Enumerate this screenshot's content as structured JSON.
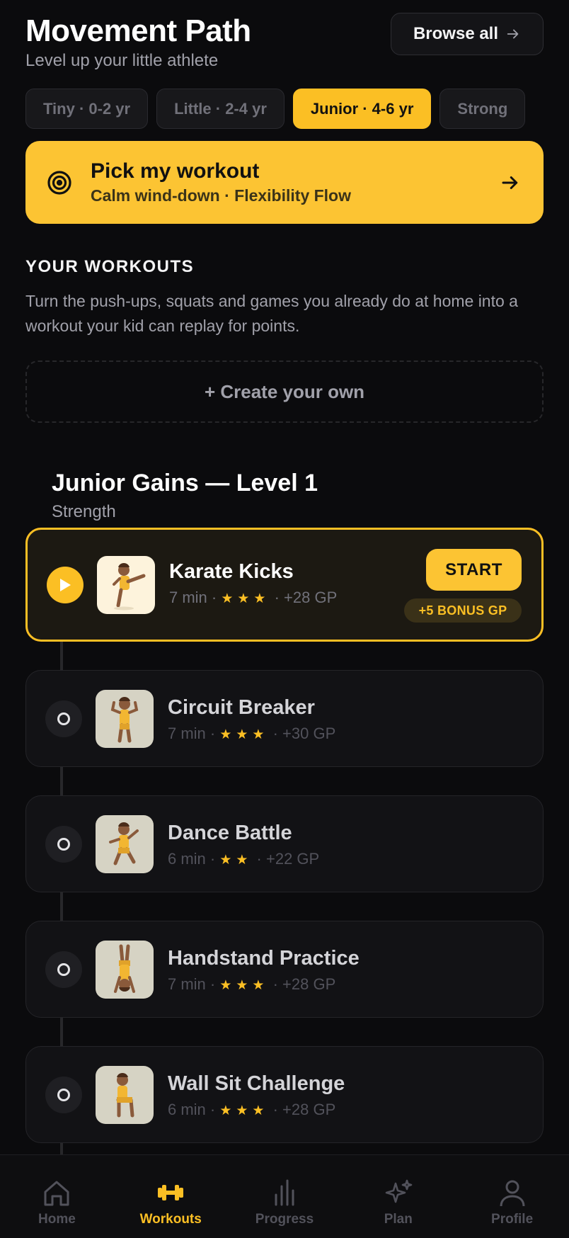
{
  "header": {
    "title": "Movement Path",
    "subtitle": "Level up your little athlete",
    "browse_label": "Browse all"
  },
  "age_filters": [
    {
      "label": "Tiny · 0-2 yr",
      "active": false
    },
    {
      "label": "Little · 2-4 yr",
      "active": false
    },
    {
      "label": "Junior · 4-6 yr",
      "active": true
    },
    {
      "label": "Strong",
      "active": false
    }
  ],
  "pick_card": {
    "title": "Pick my workout",
    "subtitle": "Calm wind-down · Flexibility Flow"
  },
  "workouts_section": {
    "heading": "YOUR WORKOUTS",
    "description": "Turn the push-ups, squats and games you already do at home into a workout your kid can replay for points.",
    "create_label": "+ Create your own"
  },
  "group": {
    "title": "Junior Gains — Level 1",
    "subtitle": "Strength"
  },
  "workouts": [
    {
      "name": "Karate Kicks",
      "duration": "7 min",
      "stars": "★★★",
      "points": "+28 GP",
      "active": true,
      "start_label": "START",
      "bonus_label": "+5 BONUS GP"
    },
    {
      "name": "Circuit Breaker",
      "duration": "7 min",
      "stars": "★★★",
      "points": "+30 GP",
      "active": false
    },
    {
      "name": "Dance Battle",
      "duration": "6 min",
      "stars": "★★",
      "points": "+22 GP",
      "active": false
    },
    {
      "name": "Handstand Practice",
      "duration": "7 min",
      "stars": "★★★",
      "points": "+28 GP",
      "active": false
    },
    {
      "name": "Wall Sit Challenge",
      "duration": "6 min",
      "stars": "★★★",
      "points": "+28 GP",
      "active": false
    }
  ],
  "tabs": [
    {
      "label": "Home",
      "icon": "home-icon",
      "active": false
    },
    {
      "label": "Workouts",
      "icon": "dumbbell-icon",
      "active": true
    },
    {
      "label": "Progress",
      "icon": "bar-chart-icon",
      "active": false
    },
    {
      "label": "Plan",
      "icon": "sparkles-icon",
      "active": false
    },
    {
      "label": "Profile",
      "icon": "user-icon",
      "active": false
    }
  ],
  "colors": {
    "background": "#0b0b0d",
    "accent": "#fbbf24",
    "card": "#121215"
  }
}
